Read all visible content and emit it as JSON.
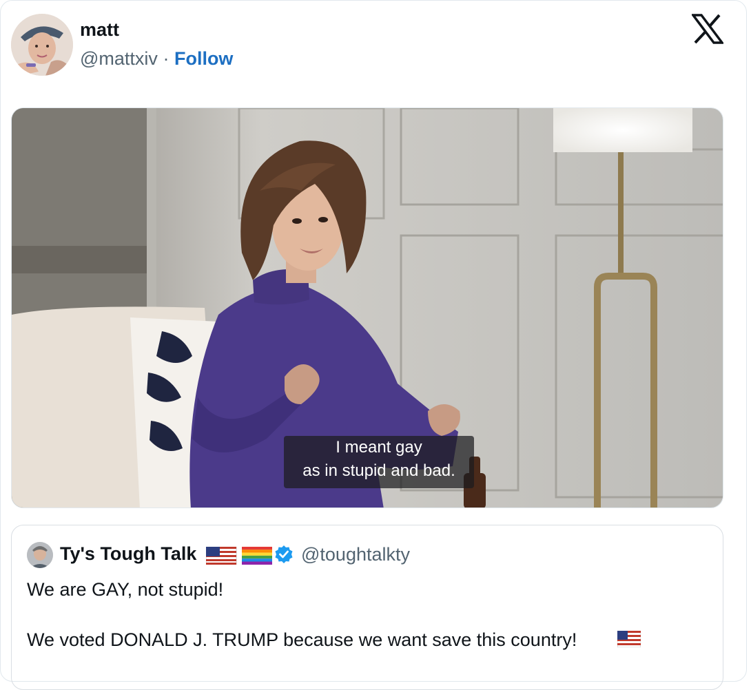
{
  "tweet": {
    "author_name": "matt",
    "author_handle": "@mattxiv",
    "separator": "·",
    "follow_label": "Follow",
    "platform_icon": "x-logo-icon",
    "media": {
      "caption_line1": "I meant gay",
      "caption_line2": "as in stupid and bad."
    }
  },
  "quoted": {
    "author_name": "Ty's Tough Talk",
    "name_emojis": [
      "us-flag-icon",
      "rainbow-flag-icon"
    ],
    "verified_icon": "verified-badge-icon",
    "author_handle": "@toughtalkty",
    "text_line1": "We are GAY, not stupid!",
    "text_line2": "We voted DONALD J. TRUMP because we want save this country!",
    "trailing_emoji": "us-flag-icon"
  },
  "colors": {
    "follow": "#1d6fc2",
    "verified": "#1d9bf0",
    "muted_text": "#536471",
    "border": "#e1e8ed"
  }
}
